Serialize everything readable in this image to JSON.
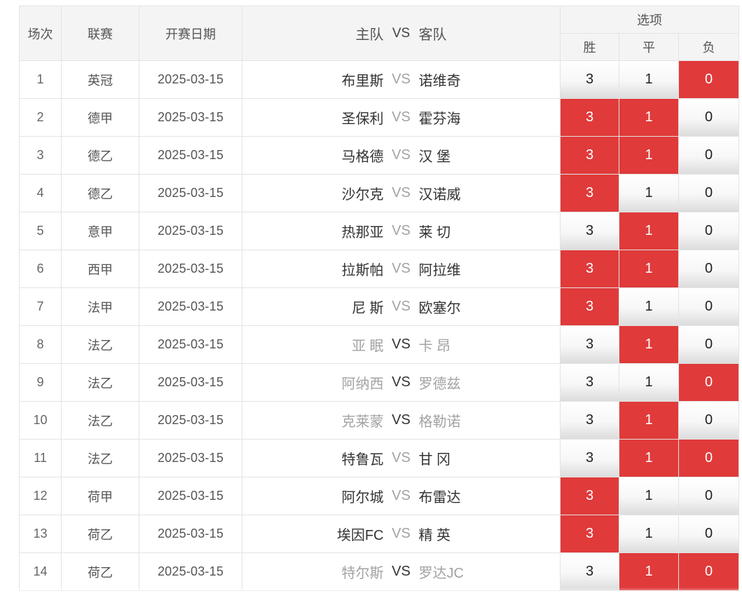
{
  "header": {
    "col_index": "场次",
    "col_league": "联赛",
    "col_date": "开赛日期",
    "col_home": "主队",
    "col_vs": "VS",
    "col_away": "客队",
    "col_options": "选项",
    "opt_win": "胜",
    "opt_draw": "平",
    "opt_lose": "负"
  },
  "colors": {
    "selected": "#e03a3a",
    "muted_team": "#a3a3a3"
  },
  "rows": [
    {
      "index": "1",
      "league": "英冠",
      "date": "2025-03-15",
      "home": "布里斯",
      "vs": "VS",
      "away": "诺维奇",
      "muted": false,
      "opt_win": "3",
      "opt_draw": "1",
      "opt_lose": "0",
      "sel_win": false,
      "sel_draw": false,
      "sel_lose": true
    },
    {
      "index": "2",
      "league": "德甲",
      "date": "2025-03-15",
      "home": "圣保利",
      "vs": "VS",
      "away": "霍芬海",
      "muted": false,
      "opt_win": "3",
      "opt_draw": "1",
      "opt_lose": "0",
      "sel_win": true,
      "sel_draw": true,
      "sel_lose": false
    },
    {
      "index": "3",
      "league": "德乙",
      "date": "2025-03-15",
      "home": "马格德",
      "vs": "VS",
      "away": "汉 堡",
      "muted": false,
      "opt_win": "3",
      "opt_draw": "1",
      "opt_lose": "0",
      "sel_win": true,
      "sel_draw": true,
      "sel_lose": false
    },
    {
      "index": "4",
      "league": "德乙",
      "date": "2025-03-15",
      "home": "沙尔克",
      "vs": "VS",
      "away": "汉诺威",
      "muted": false,
      "opt_win": "3",
      "opt_draw": "1",
      "opt_lose": "0",
      "sel_win": true,
      "sel_draw": false,
      "sel_lose": false
    },
    {
      "index": "5",
      "league": "意甲",
      "date": "2025-03-15",
      "home": "热那亚",
      "vs": "VS",
      "away": "莱 切",
      "muted": false,
      "opt_win": "3",
      "opt_draw": "1",
      "opt_lose": "0",
      "sel_win": false,
      "sel_draw": true,
      "sel_lose": false
    },
    {
      "index": "6",
      "league": "西甲",
      "date": "2025-03-15",
      "home": "拉斯帕",
      "vs": "VS",
      "away": "阿拉维",
      "muted": false,
      "opt_win": "3",
      "opt_draw": "1",
      "opt_lose": "0",
      "sel_win": true,
      "sel_draw": true,
      "sel_lose": false
    },
    {
      "index": "7",
      "league": "法甲",
      "date": "2025-03-15",
      "home": "尼 斯",
      "vs": "VS",
      "away": "欧塞尔",
      "muted": false,
      "opt_win": "3",
      "opt_draw": "1",
      "opt_lose": "0",
      "sel_win": true,
      "sel_draw": false,
      "sel_lose": false
    },
    {
      "index": "8",
      "league": "法乙",
      "date": "2025-03-15",
      "home": "亚 眠",
      "vs": "VS",
      "away": "卡 昂",
      "muted": true,
      "opt_win": "3",
      "opt_draw": "1",
      "opt_lose": "0",
      "sel_win": false,
      "sel_draw": true,
      "sel_lose": false
    },
    {
      "index": "9",
      "league": "法乙",
      "date": "2025-03-15",
      "home": "阿纳西",
      "vs": "VS",
      "away": "罗德兹",
      "muted": true,
      "opt_win": "3",
      "opt_draw": "1",
      "opt_lose": "0",
      "sel_win": false,
      "sel_draw": false,
      "sel_lose": true
    },
    {
      "index": "10",
      "league": "法乙",
      "date": "2025-03-15",
      "home": "克莱蒙",
      "vs": "VS",
      "away": "格勒诺",
      "muted": true,
      "opt_win": "3",
      "opt_draw": "1",
      "opt_lose": "0",
      "sel_win": false,
      "sel_draw": true,
      "sel_lose": false
    },
    {
      "index": "11",
      "league": "法乙",
      "date": "2025-03-15",
      "home": "特鲁瓦",
      "vs": "VS",
      "away": "甘 冈",
      "muted": false,
      "opt_win": "3",
      "opt_draw": "1",
      "opt_lose": "0",
      "sel_win": false,
      "sel_draw": true,
      "sel_lose": true
    },
    {
      "index": "12",
      "league": "荷甲",
      "date": "2025-03-15",
      "home": "阿尔城",
      "vs": "VS",
      "away": "布雷达",
      "muted": false,
      "opt_win": "3",
      "opt_draw": "1",
      "opt_lose": "0",
      "sel_win": true,
      "sel_draw": false,
      "sel_lose": false
    },
    {
      "index": "13",
      "league": "荷乙",
      "date": "2025-03-15",
      "home": "埃因FC",
      "vs": "VS",
      "away": "精 英",
      "muted": false,
      "opt_win": "3",
      "opt_draw": "1",
      "opt_lose": "0",
      "sel_win": true,
      "sel_draw": false,
      "sel_lose": false
    },
    {
      "index": "14",
      "league": "荷乙",
      "date": "2025-03-15",
      "home": "特尔斯",
      "vs": "VS",
      "away": "罗达JC",
      "muted": true,
      "opt_win": "3",
      "opt_draw": "1",
      "opt_lose": "0",
      "sel_win": false,
      "sel_draw": true,
      "sel_lose": true
    }
  ]
}
